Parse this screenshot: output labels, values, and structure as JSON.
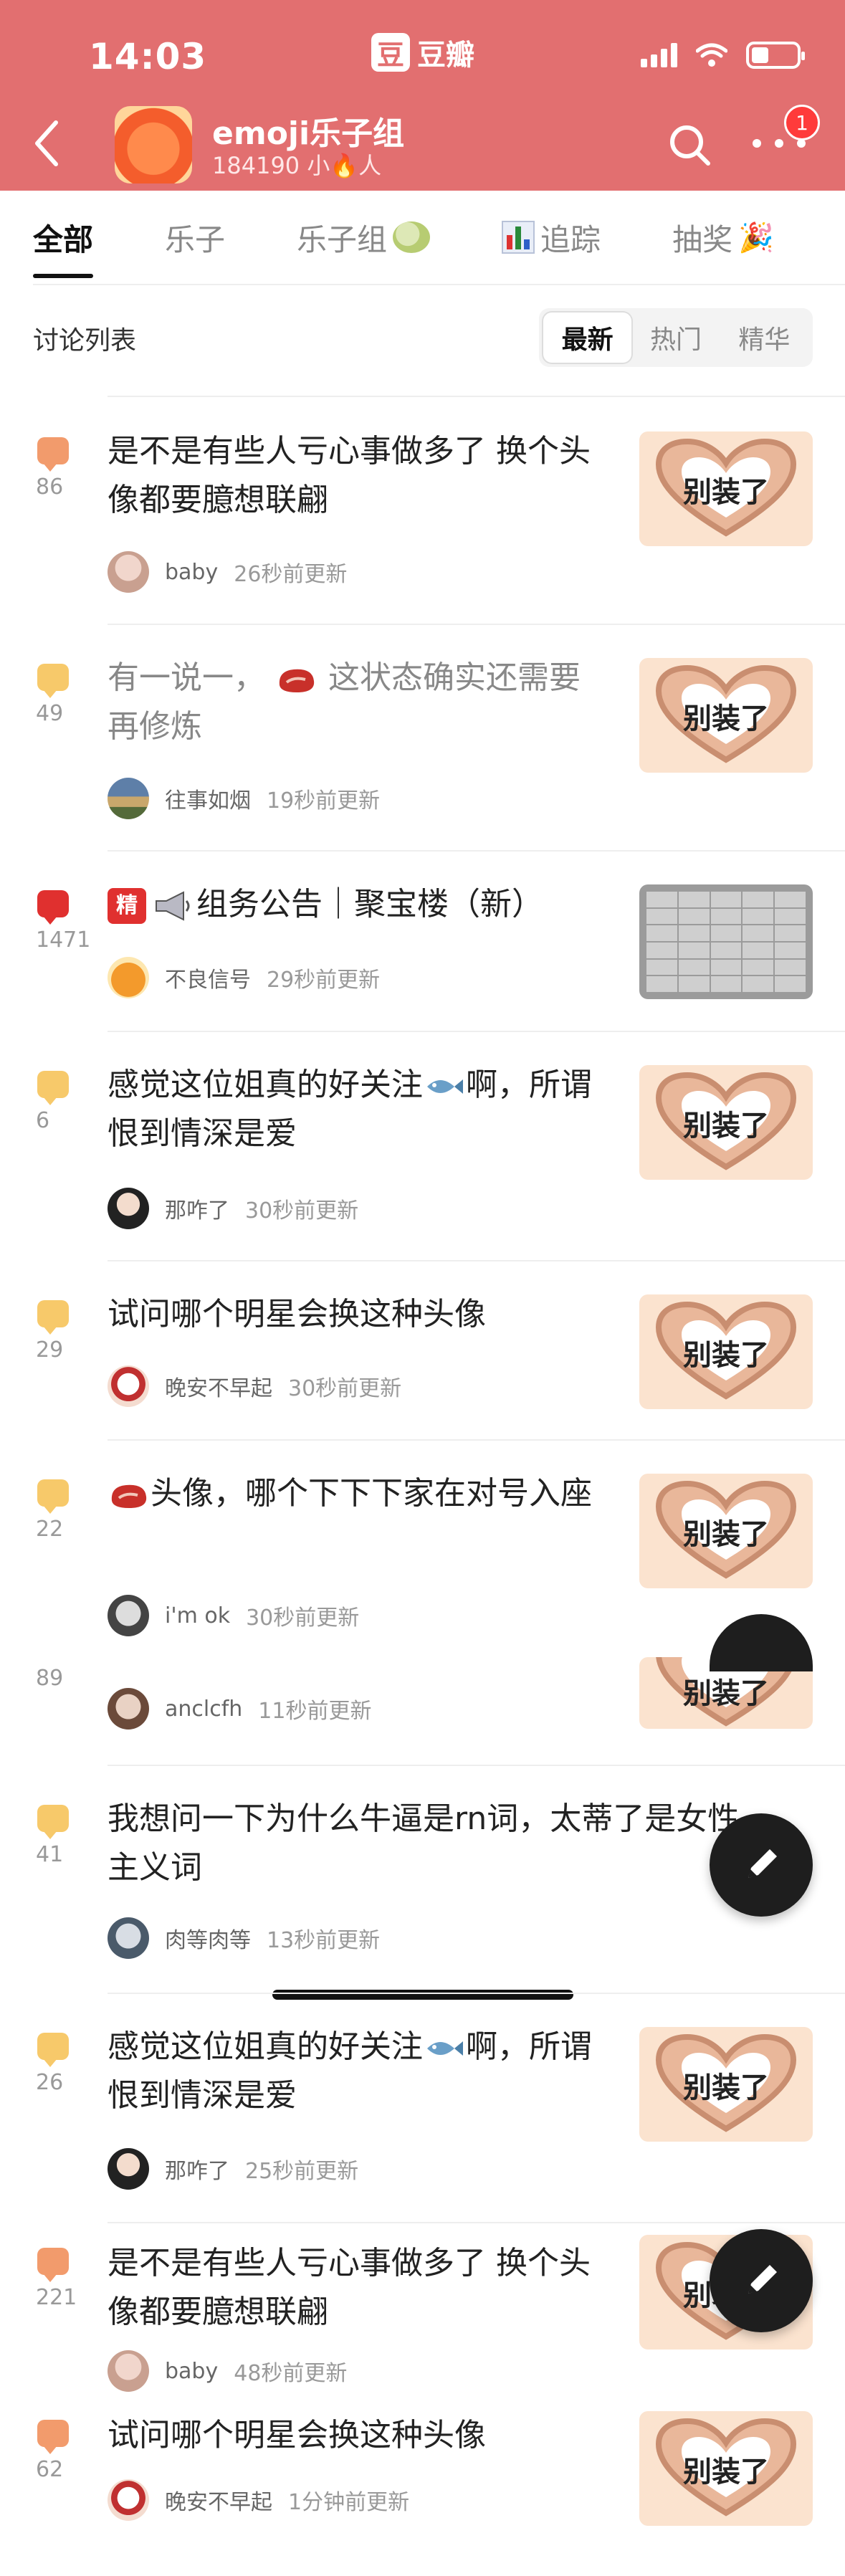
{
  "status_bar": {
    "time": "14:03",
    "app_logo_char": "豆",
    "app_name": "豆瓣"
  },
  "header": {
    "title": "emoji乐子组",
    "member_count": "184190",
    "member_suffix": "小🔥人",
    "notification_count": "1"
  },
  "tabs": [
    {
      "label": "全部",
      "active": true
    },
    {
      "label": "乐子",
      "active": false
    },
    {
      "label": "乐子组",
      "icon": "melon-icon",
      "active": false
    },
    {
      "label": "追踪",
      "icon": "bar-chart-icon",
      "active": false
    },
    {
      "label": "抽奖",
      "icon": "party-popper-icon",
      "active": false
    }
  ],
  "list_title": "讨论列表",
  "sort_options": [
    "最新",
    "热门",
    "精华"
  ],
  "sort_selected": "最新",
  "thumb_caption": "别装了",
  "colors": {
    "header_bg": "#e26f70",
    "bubble_yellow": "#f7c96a",
    "bubble_orange": "#f29b6c",
    "bubble_red": "#e0302f",
    "fab": "#1e1e1e"
  },
  "posts": [
    {
      "reply_count": "86",
      "bubble": "orange",
      "title": "是不是有些人亏心事做多了 换个头像都要臆想联翩",
      "author": "baby",
      "updated": "26秒前更新",
      "thumb": "heart"
    },
    {
      "reply_count": "49",
      "bubble": "yellow",
      "title_a": "有一说一，",
      "title_b": "这状态确实还需要再修炼",
      "inline_icon": "steak-icon",
      "author": "往事如烟",
      "updated": "19秒前更新",
      "thumb": "heart",
      "read": true
    },
    {
      "reply_count": "1471",
      "bubble": "red",
      "badge": "精",
      "title": "组务公告｜聚宝楼（新）",
      "inline_icon": "megaphone-icon",
      "author": "不良信号",
      "updated": "29秒前更新",
      "thumb": "table"
    },
    {
      "reply_count": "6",
      "bubble": "yellow",
      "title_a": "感觉这位姐真的好关注",
      "title_b": "啊，所谓恨到情深是爱",
      "inline_icon": "fish-icon",
      "author": "那咋了",
      "updated": "30秒前更新",
      "thumb": "heart"
    },
    {
      "reply_count": "29",
      "bubble": "yellow",
      "title": "试问哪个明星会换这种头像",
      "author": "晚安不早起",
      "updated": "30秒前更新",
      "thumb": "heart"
    },
    {
      "reply_count": "22",
      "bubble": "yellow",
      "title_b": "头像，哪个下下下家在对号入座",
      "inline_icon": "steak-icon",
      "author": "i'm ok",
      "updated": "30秒前更新",
      "thumb": "heart"
    },
    {
      "reply_count": "89",
      "bubble": "yellow",
      "author": "anclcfh",
      "updated": "11秒前更新",
      "thumb": "heart"
    },
    {
      "reply_count": "41",
      "bubble": "yellow",
      "title": "我想问一下为什么牛逼是rn词，太蒂了是女性主义词",
      "author": "肉等肉等",
      "updated": "13秒前更新"
    },
    {
      "reply_count": "26",
      "bubble": "yellow",
      "title_a": "感觉这位姐真的好关注",
      "title_b": "啊，所谓恨到情深是爱",
      "inline_icon": "fish-icon",
      "author": "那咋了",
      "updated": "25秒前更新",
      "thumb": "heart"
    },
    {
      "reply_count": "221",
      "bubble": "orange",
      "title": "是不是有些人亏心事做多了 换个头像都要臆想联翩",
      "author": "baby",
      "updated": "48秒前更新",
      "thumb": "heart"
    },
    {
      "reply_count": "62",
      "bubble": "orange",
      "title": "试问哪个明星会换这种头像",
      "author": "晚安不早起",
      "updated": "1分钟前更新",
      "thumb": "heart"
    }
  ]
}
